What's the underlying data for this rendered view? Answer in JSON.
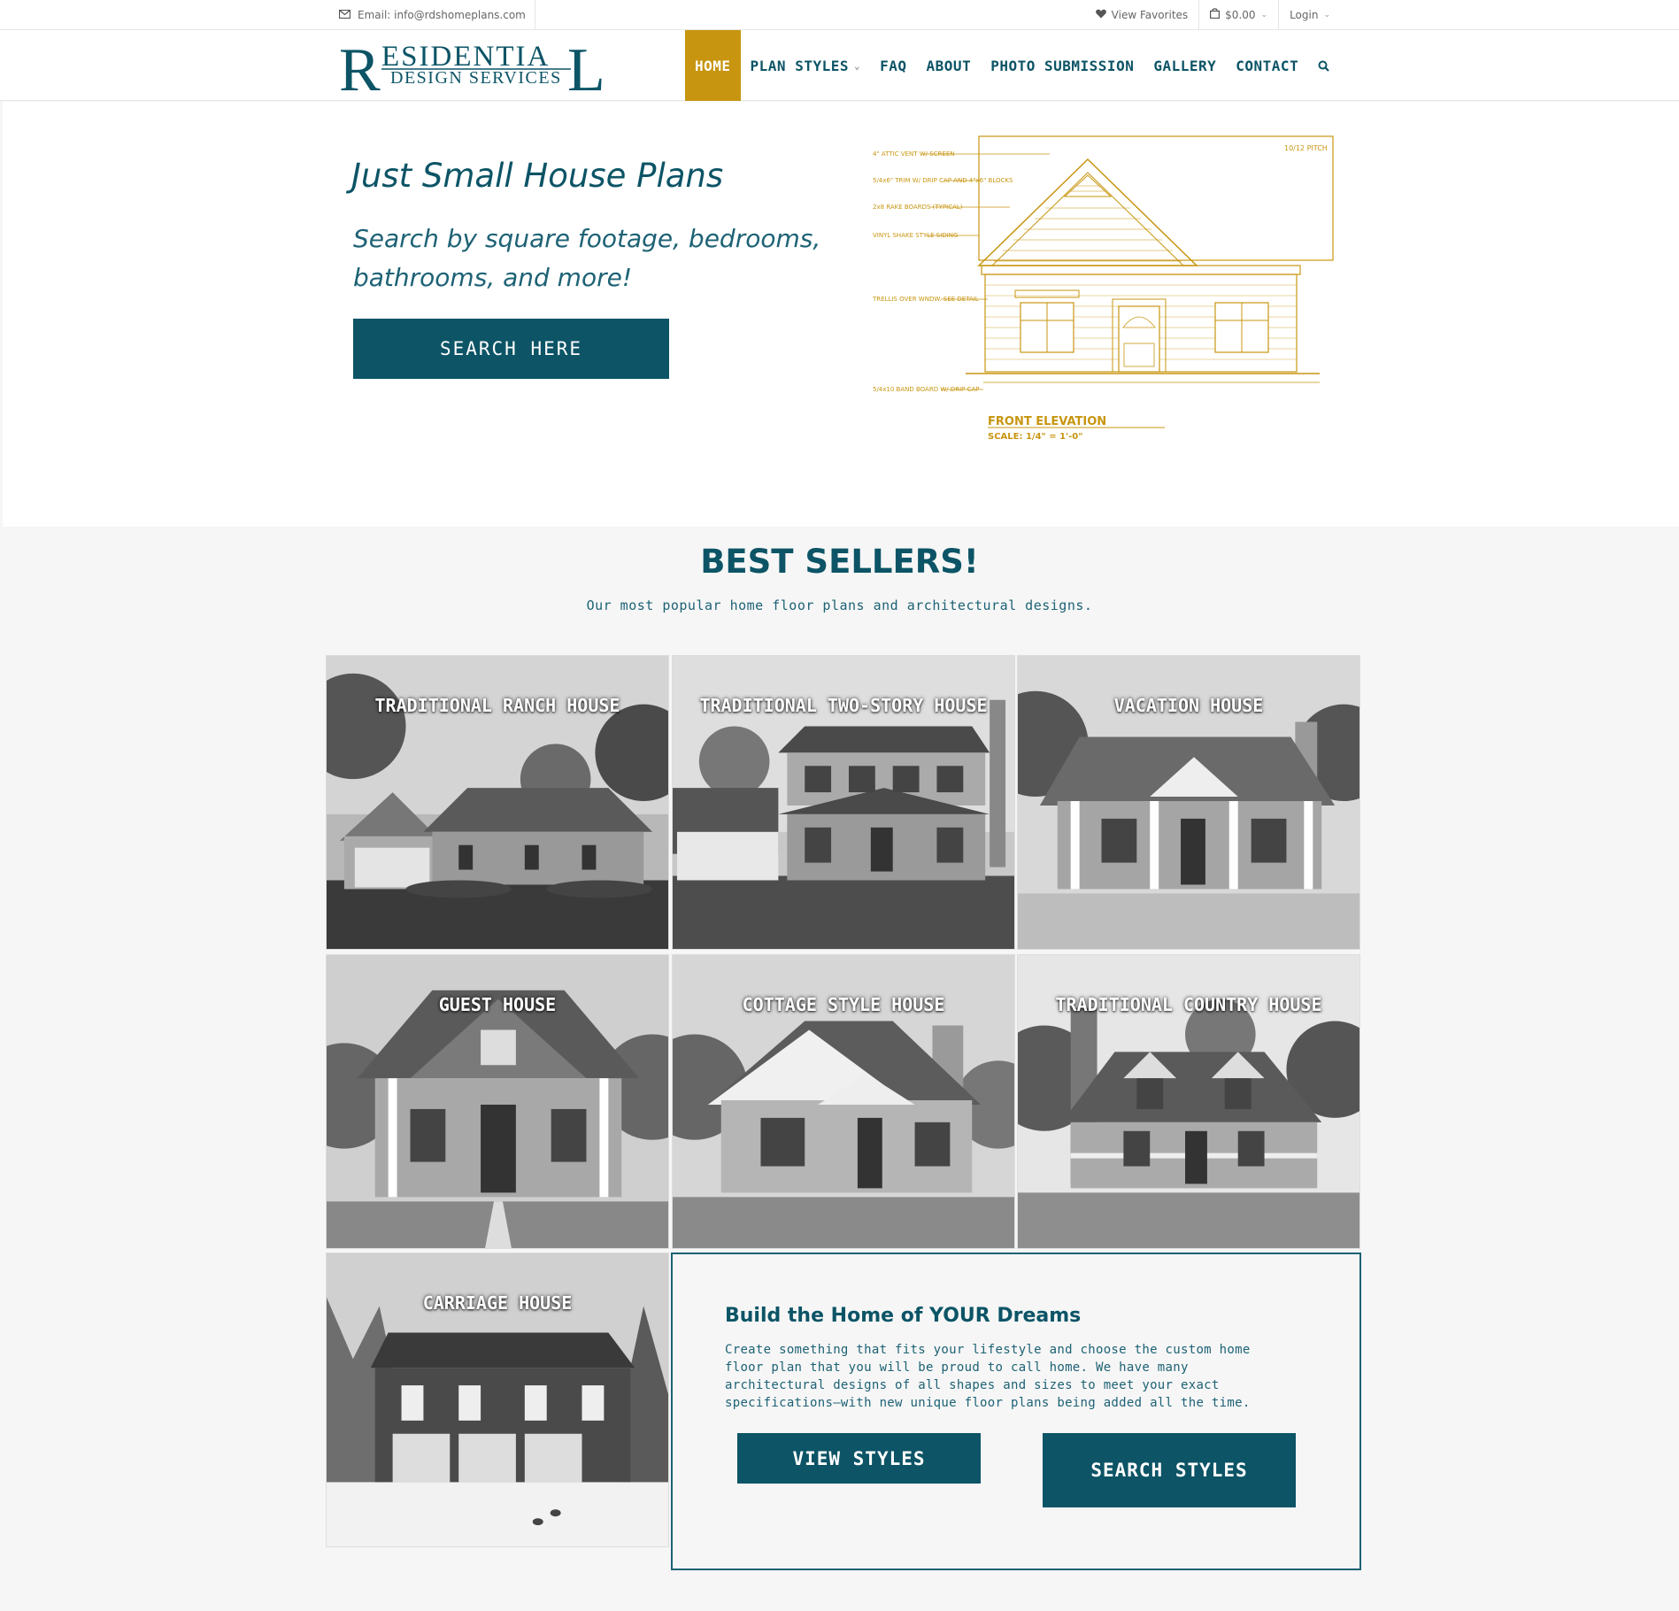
{
  "topbar": {
    "email": "Email: info@rdshomeplans.com",
    "favorites": "View Favorites",
    "cart": "$0.00",
    "login": "Login"
  },
  "logo": {
    "line1_big_r": "R",
    "line1_rest": "ESIDENTIA",
    "line1_big_l": "L",
    "line2": "DESIGN SERVICES"
  },
  "nav": {
    "items": [
      "HOME",
      "PLAN STYLES",
      "FAQ",
      "ABOUT",
      "PHOTO SUBMISSION",
      "GALLERY",
      "CONTACT"
    ]
  },
  "hero": {
    "title": "Just Small House Plans",
    "subtitle": "Search by square footage, bedrooms, bathrooms, and more!",
    "button": "SEARCH HERE",
    "drawing": {
      "pitch": "10/12 PITCH",
      "note1": "4\" ATTIC VENT W/ SCREEN",
      "note2": "5/4x6\" TRIM W/ DRIP CAP AND 4\"x6\" BLOCKS",
      "note3": "2x8 RAKE BOARDS (TYPICAL)",
      "note4": "VINYL SHAKE STYLE SIDING",
      "note5": "TRELLIS OVER WNDW. SEE DETAIL",
      "note6": "5/4x10 BAND BOARD W/ DRIP CAP",
      "caption": "FRONT ELEVATION",
      "scale": "SCALE: 1/4\" = 1'-0\""
    }
  },
  "best_sellers": {
    "title": "BEST SELLERS!",
    "subtitle": "Our most popular home floor plans and architectural designs.",
    "cards": [
      "TRADITIONAL RANCH HOUSE",
      "TRADITIONAL TWO-STORY HOUSE",
      "VACATION HOUSE",
      "GUEST HOUSE",
      "COTTAGE STYLE HOUSE",
      "TRADITIONAL COUNTRY HOUSE",
      "CARRIAGE HOUSE"
    ]
  },
  "dreams": {
    "title": "Build the Home of YOUR Dreams",
    "text": "Create something that fits your lifestyle and choose the custom home floor plan that you will be proud to call home. We have many architectural designs of all shapes and sizes to meet your exact specifications—with new unique floor plans being added all the time.",
    "button1": "VIEW STYLES",
    "button2": "SEARCH STYLES"
  },
  "colors": {
    "primary": "#0c5466",
    "gold": "#c7950f"
  }
}
